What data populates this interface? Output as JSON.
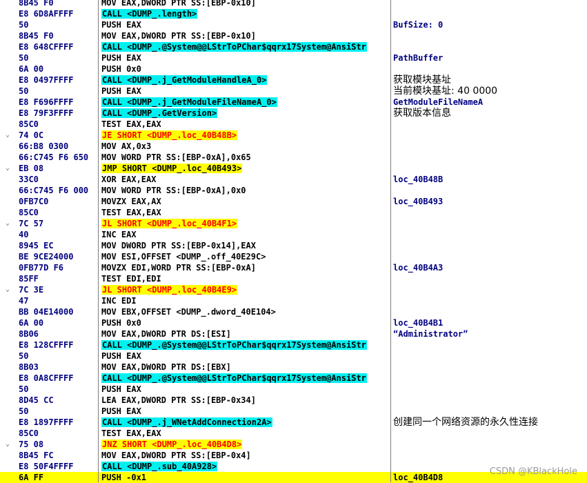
{
  "colors": {
    "call_highlight": "#00f0f0",
    "jump_highlight": "#ffff00",
    "jump_text": "#ff0000",
    "selected_row": "#ffff00",
    "bytes_text": "#000080"
  },
  "watermark": "CSDN @KBlackHole",
  "rows": [
    {
      "gutter": "",
      "bytes": "8B45 F0",
      "instr": "MOV EAX,DWORD PTR SS:[EBP-0x10]",
      "hl": "",
      "comment": ""
    },
    {
      "gutter": "",
      "bytes": "E8 6D8AFFFF",
      "instr": "CALL <DUMP_.length>",
      "hl": "call",
      "comment": ""
    },
    {
      "gutter": "",
      "bytes": "50",
      "instr": "PUSH EAX",
      "hl": "",
      "comment": "BufSize: 0"
    },
    {
      "gutter": "",
      "bytes": "8B45 F0",
      "instr": "MOV EAX,DWORD PTR SS:[EBP-0x10]",
      "hl": "",
      "comment": ""
    },
    {
      "gutter": "",
      "bytes": "E8 648CFFFF",
      "instr": "CALL <DUMP_.@System@@LStrToPChar$qqrx17System@AnsiStr",
      "hl": "call",
      "comment": ""
    },
    {
      "gutter": "",
      "bytes": "50",
      "instr": "PUSH EAX",
      "hl": "",
      "comment": "PathBuffer"
    },
    {
      "gutter": "",
      "bytes": "6A 00",
      "instr": "PUSH 0x0",
      "hl": "",
      "comment": ""
    },
    {
      "gutter": "",
      "bytes": "E8 0497FFFF",
      "instr": "CALL <DUMP_.j_GetModuleHandleA_0>",
      "hl": "call",
      "comment": "获取模块基址",
      "cjk": true
    },
    {
      "gutter": "",
      "bytes": "50",
      "instr": "PUSH EAX",
      "hl": "",
      "comment": "当前模块基址: 40 0000",
      "cjk": true
    },
    {
      "gutter": "",
      "bytes": "E8 F696FFFF",
      "instr": "CALL <DUMP_.j_GetModuleFileNameA_0>",
      "hl": "call",
      "comment": "GetModuleFileNameA"
    },
    {
      "gutter": "",
      "bytes": "E8 79F3FFFF",
      "instr": "CALL <DUMP_.GetVersion>",
      "hl": "call",
      "comment": "获取版本信息",
      "cjk": true
    },
    {
      "gutter": "",
      "bytes": "85C0",
      "instr": "TEST EAX,EAX",
      "hl": "",
      "comment": ""
    },
    {
      "gutter": "v",
      "bytes": "74 0C",
      "instr": "JE SHORT <DUMP_.loc_40B48B>",
      "hl": "jump",
      "comment": ""
    },
    {
      "gutter": "",
      "bytes": "66:B8 0300",
      "instr": "MOV AX,0x3",
      "hl": "",
      "comment": ""
    },
    {
      "gutter": "",
      "bytes": "66:C745 F6 650",
      "instr": "MOV WORD PTR SS:[EBP-0xA],0x65",
      "hl": "",
      "comment": ""
    },
    {
      "gutter": "v",
      "bytes": "EB 08",
      "instr": "JMP SHORT <DUMP_.loc_40B493>",
      "hl": "jmp",
      "comment": ""
    },
    {
      "gutter": "",
      "bytes": "33C0",
      "instr": "XOR EAX,EAX",
      "hl": "",
      "comment": "loc_40B48B"
    },
    {
      "gutter": "",
      "bytes": "66:C745 F6 000",
      "instr": "MOV WORD PTR SS:[EBP-0xA],0x0",
      "hl": "",
      "comment": ""
    },
    {
      "gutter": "",
      "bytes": "0FB7C0",
      "instr": "MOVZX EAX,AX",
      "hl": "",
      "comment": "loc_40B493"
    },
    {
      "gutter": "",
      "bytes": "85C0",
      "instr": "TEST EAX,EAX",
      "hl": "",
      "comment": ""
    },
    {
      "gutter": "v",
      "bytes": "7C 57",
      "instr": "JL SHORT <DUMP_.loc_40B4F1>",
      "hl": "jump",
      "comment": ""
    },
    {
      "gutter": "",
      "bytes": "40",
      "instr": "INC EAX",
      "hl": "",
      "comment": ""
    },
    {
      "gutter": "",
      "bytes": "8945 EC",
      "instr": "MOV DWORD PTR SS:[EBP-0x14],EAX",
      "hl": "",
      "comment": ""
    },
    {
      "gutter": "",
      "bytes": "BE 9CE24000",
      "instr": "MOV ESI,OFFSET <DUMP_.off_40E29C>",
      "hl": "",
      "comment": ""
    },
    {
      "gutter": "",
      "bytes": "0FB77D F6",
      "instr": "MOVZX EDI,WORD PTR SS:[EBP-0xA]",
      "hl": "",
      "comment": "loc_40B4A3"
    },
    {
      "gutter": "",
      "bytes": "85FF",
      "instr": "TEST EDI,EDI",
      "hl": "",
      "comment": ""
    },
    {
      "gutter": "v",
      "bytes": "7C 3E",
      "instr": "JL SHORT <DUMP_.loc_40B4E9>",
      "hl": "jump",
      "comment": ""
    },
    {
      "gutter": "",
      "bytes": "47",
      "instr": "INC EDI",
      "hl": "",
      "comment": ""
    },
    {
      "gutter": "",
      "bytes": "BB 04E14000",
      "instr": "MOV EBX,OFFSET <DUMP_.dword_40E104>",
      "hl": "",
      "comment": ""
    },
    {
      "gutter": "",
      "bytes": "6A 00",
      "instr": "PUSH 0x0",
      "hl": "",
      "comment": "loc_40B4B1"
    },
    {
      "gutter": "",
      "bytes": "8B06",
      "instr": "MOV EAX,DWORD PTR DS:[ESI]",
      "hl": "",
      "comment": "“Administrator”"
    },
    {
      "gutter": "",
      "bytes": "E8 128CFFFF",
      "instr": "CALL <DUMP_.@System@@LStrToPChar$qqrx17System@AnsiStr",
      "hl": "call",
      "comment": ""
    },
    {
      "gutter": "",
      "bytes": "50",
      "instr": "PUSH EAX",
      "hl": "",
      "comment": ""
    },
    {
      "gutter": "",
      "bytes": "8B03",
      "instr": "MOV EAX,DWORD PTR DS:[EBX]",
      "hl": "",
      "comment": ""
    },
    {
      "gutter": "",
      "bytes": "E8 0A8CFFFF",
      "instr": "CALL <DUMP_.@System@@LStrToPChar$qqrx17System@AnsiStr",
      "hl": "call",
      "comment": ""
    },
    {
      "gutter": "",
      "bytes": "50",
      "instr": "PUSH EAX",
      "hl": "",
      "comment": ""
    },
    {
      "gutter": "",
      "bytes": "8D45 CC",
      "instr": "LEA EAX,DWORD PTR SS:[EBP-0x34]",
      "hl": "",
      "comment": ""
    },
    {
      "gutter": "",
      "bytes": "50",
      "instr": "PUSH EAX",
      "hl": "",
      "comment": ""
    },
    {
      "gutter": "",
      "bytes": "E8 1897FFFF",
      "instr": "CALL <DUMP_.j_WNetAddConnection2A>",
      "hl": "call",
      "comment": "创建同一个网络资源的永久性连接",
      "cjk": true
    },
    {
      "gutter": "",
      "bytes": "85C0",
      "instr": "TEST EAX,EAX",
      "hl": "",
      "comment": ""
    },
    {
      "gutter": "v",
      "bytes": "75 08",
      "instr": "JNZ SHORT <DUMP_.loc_40B4D8>",
      "hl": "jump",
      "comment": ""
    },
    {
      "gutter": "",
      "bytes": "8B45 FC",
      "instr": "MOV EAX,DWORD PTR SS:[EBP-0x4]",
      "hl": "",
      "comment": ""
    },
    {
      "gutter": "",
      "bytes": "E8 50F4FFFF",
      "instr": "CALL <DUMP_.sub_40A928>",
      "hl": "call",
      "comment": ""
    },
    {
      "gutter": "",
      "bytes": "6A FF",
      "instr": "PUSH -0x1",
      "hl": "",
      "comment": "loc_40B4D8",
      "selected": true
    }
  ]
}
